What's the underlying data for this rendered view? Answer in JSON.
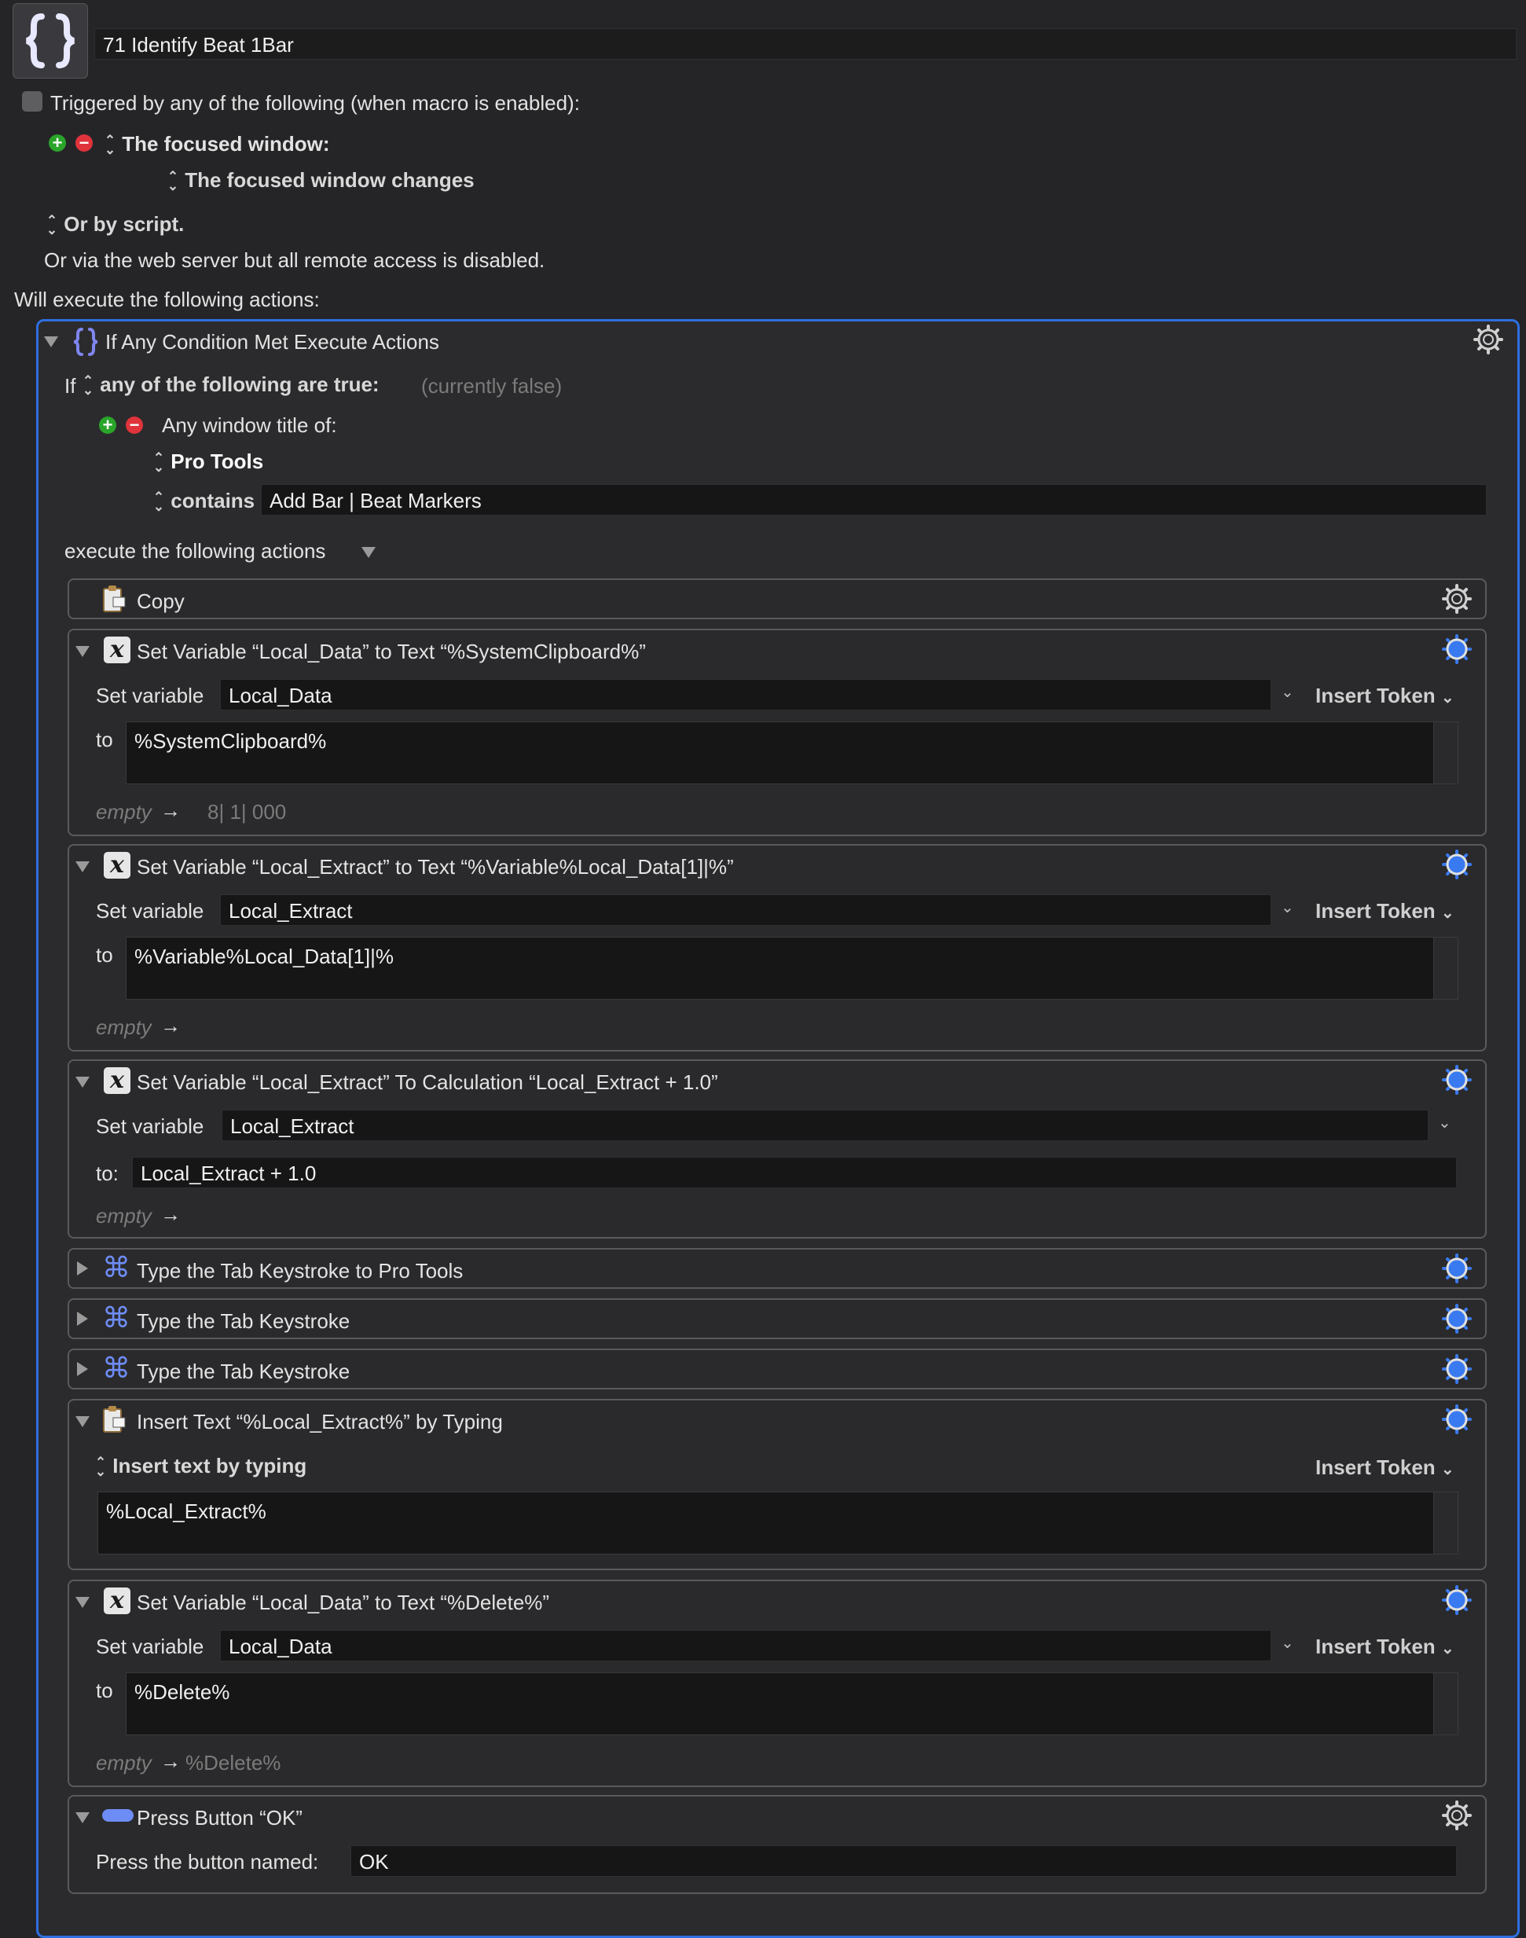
{
  "macro": {
    "name": "71 Identify Beat 1Bar"
  },
  "triggers": {
    "heading": "Triggered by any of the following (when macro is enabled):",
    "trigger_label": "The focused window:",
    "trigger_value": "The focused window changes",
    "or_by_script": "Or by script.",
    "web_server": "Or via the web server but all remote access is disabled."
  },
  "will_execute": "Will execute the following actions:",
  "if_action": {
    "title": "If Any Condition Met Execute Actions",
    "if_word": "If",
    "condition_mode": "any of the following are true:",
    "state": "(currently false)",
    "condition": "Any window title of:",
    "app": "Pro Tools",
    "operator": "contains",
    "value": "Add Bar | Beat Markers",
    "execute_label": "execute the following actions"
  },
  "actions": [
    {
      "title": "Copy"
    },
    {
      "title": "Set Variable “Local_Data” to Text “%SystemClipboard%”",
      "set_label": "Set variable",
      "variable": "Local_Data",
      "to_label": "to",
      "text": "%SystemClipboard%",
      "insert_token": "Insert Token",
      "empty": "empty",
      "result": "8| 1| 000"
    },
    {
      "title": "Set Variable “Local_Extract” to Text “%Variable%Local_Data[1]|%”",
      "set_label": "Set variable",
      "variable": "Local_Extract",
      "to_label": "to",
      "text": "%Variable%Local_Data[1]|%",
      "insert_token": "Insert Token",
      "empty": "empty",
      "result": ""
    },
    {
      "title": "Set Variable “Local_Extract” To Calculation “Local_Extract + 1.0”",
      "set_label": "Set variable",
      "variable": "Local_Extract",
      "to_label": "to:",
      "text": "Local_Extract + 1.0",
      "empty": "empty"
    },
    {
      "title": "Type the Tab Keystroke to Pro Tools"
    },
    {
      "title": "Type the Tab Keystroke"
    },
    {
      "title": "Type the Tab Keystroke"
    },
    {
      "title": "Insert Text “%Local_Extract%” by Typing",
      "mode": "Insert text by typing",
      "insert_token": "Insert Token",
      "text": "%Local_Extract%"
    },
    {
      "title": "Set Variable “Local_Data” to Text “%Delete%”",
      "set_label": "Set variable",
      "variable": "Local_Data",
      "to_label": "to",
      "text": "%Delete%",
      "insert_token": "Insert Token",
      "empty": "empty",
      "result": "%Delete%"
    },
    {
      "title": "Press Button “OK”",
      "label": "Press the button named:",
      "button_name": "OK"
    }
  ],
  "colors": {
    "background": "#252527",
    "selection_border": "#2f6fe0",
    "gear_active": "#3a7af0",
    "command_icon": "#6e8cf5"
  }
}
